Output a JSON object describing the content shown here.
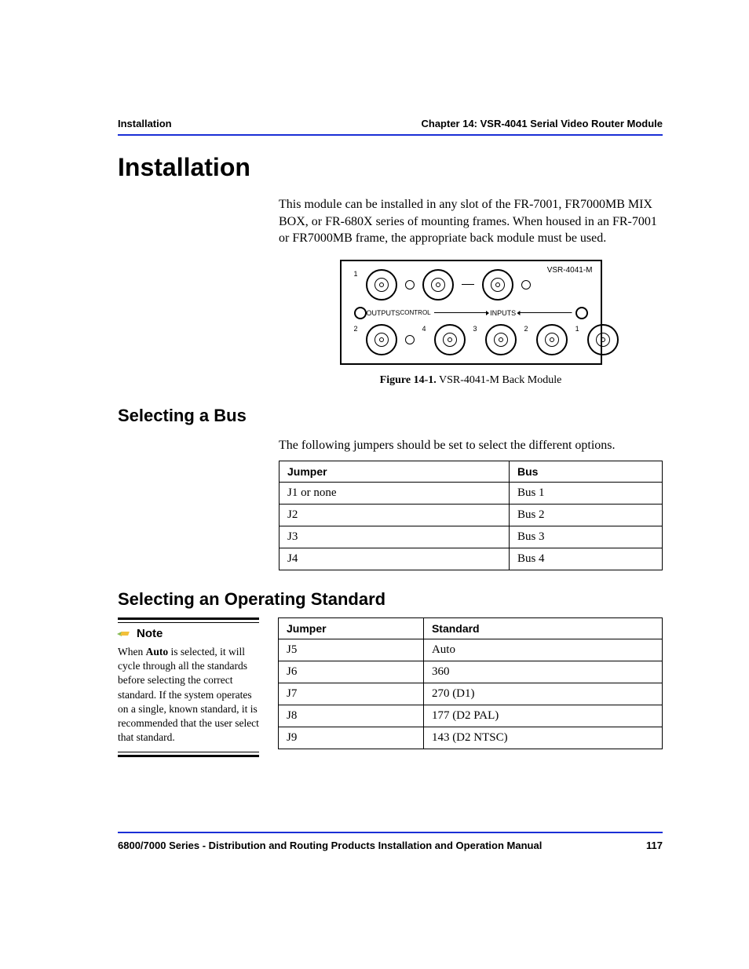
{
  "header": {
    "left": "Installation",
    "right": "Chapter 14: VSR-4041 Serial Video Router Module"
  },
  "title": "Installation",
  "intro": "This module can be installed in any slot of the FR-7001, FR7000MB MIX BOX, or FR-680X series of mounting frames. When housed in an FR-7001 or FR7000MB frame, the appropriate back module must be used.",
  "figure": {
    "model": "VSR-4041-M",
    "outputs_label": "OUTPUTS",
    "control_label": "CONTROL",
    "inputs_label": "INPUTS",
    "top_nums": [
      "1"
    ],
    "bot_nums": [
      "2",
      "4",
      "3",
      "2",
      "1"
    ],
    "caption_label": "Figure 14-1.",
    "caption_text": " VSR-4041-M Back Module"
  },
  "section_bus": {
    "heading": "Selecting a Bus",
    "lead": "The following jumpers should be set to select the different options.",
    "headers": [
      "Jumper",
      "Bus"
    ],
    "rows": [
      [
        "J1 or none",
        "Bus 1"
      ],
      [
        "J2",
        "Bus 2"
      ],
      [
        "J3",
        "Bus 3"
      ],
      [
        "J4",
        "Bus 4"
      ]
    ]
  },
  "section_std": {
    "heading": "Selecting an Operating Standard",
    "headers": [
      "Jumper",
      "Standard"
    ],
    "rows": [
      [
        "J5",
        "Auto"
      ],
      [
        "J6",
        "360"
      ],
      [
        "J7",
        "270 (D1)"
      ],
      [
        "J8",
        "177 (D2 PAL)"
      ],
      [
        "J9",
        "143 (D2 NTSC)"
      ]
    ]
  },
  "note": {
    "label": "Note",
    "pre": "When ",
    "bold": "Auto",
    "post": " is selected, it will cycle through all the standards before selecting the correct standard. If the system operates on a single, known standard, it is recommended that the user select that standard."
  },
  "footer": {
    "left": "6800/7000 Series - Distribution and Routing Products Installation and Operation Manual",
    "page": "117"
  }
}
